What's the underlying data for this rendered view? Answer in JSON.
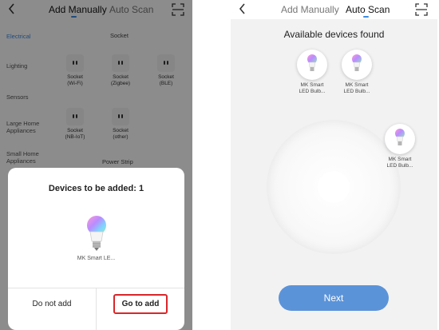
{
  "left_screen": {
    "nav": {
      "tab_manual": "Add Manually",
      "tab_auto": "Auto Scan"
    },
    "categories": [
      "Electrical",
      "Lighting",
      "Sensors",
      "Large Home Appliances",
      "Small Home Appliances"
    ],
    "section_headers": {
      "socket": "Socket",
      "power_strip": "Power Strip"
    },
    "socket_devices": [
      {
        "name": "Socket",
        "sub": "(Wi-Fi)"
      },
      {
        "name": "Socket",
        "sub": "(Zigbee)"
      },
      {
        "name": "Socket",
        "sub": "(BLE)"
      },
      {
        "name": "Socket",
        "sub": "(NB-IoT)"
      },
      {
        "name": "Socket",
        "sub": "(other)"
      }
    ],
    "dialog": {
      "title": "Devices to be added: 1",
      "device_name": "MK Smart LE...",
      "cancel_label": "Do not add",
      "confirm_label": "Go to add",
      "confirm_highlight_color": "#d9262a"
    }
  },
  "right_screen": {
    "nav": {
      "tab_manual": "Add Manually",
      "tab_auto": "Auto Scan"
    },
    "heading": "Available devices found",
    "devices": [
      {
        "line1": "MK Smart",
        "line2": "LED Bulb..."
      },
      {
        "line1": "MK Smart",
        "line2": "LED Bulb..."
      },
      {
        "line1": "MK Smart",
        "line2": "LED Bulb..."
      }
    ],
    "next_label": "Next",
    "accent_color": "#5b93d9"
  }
}
